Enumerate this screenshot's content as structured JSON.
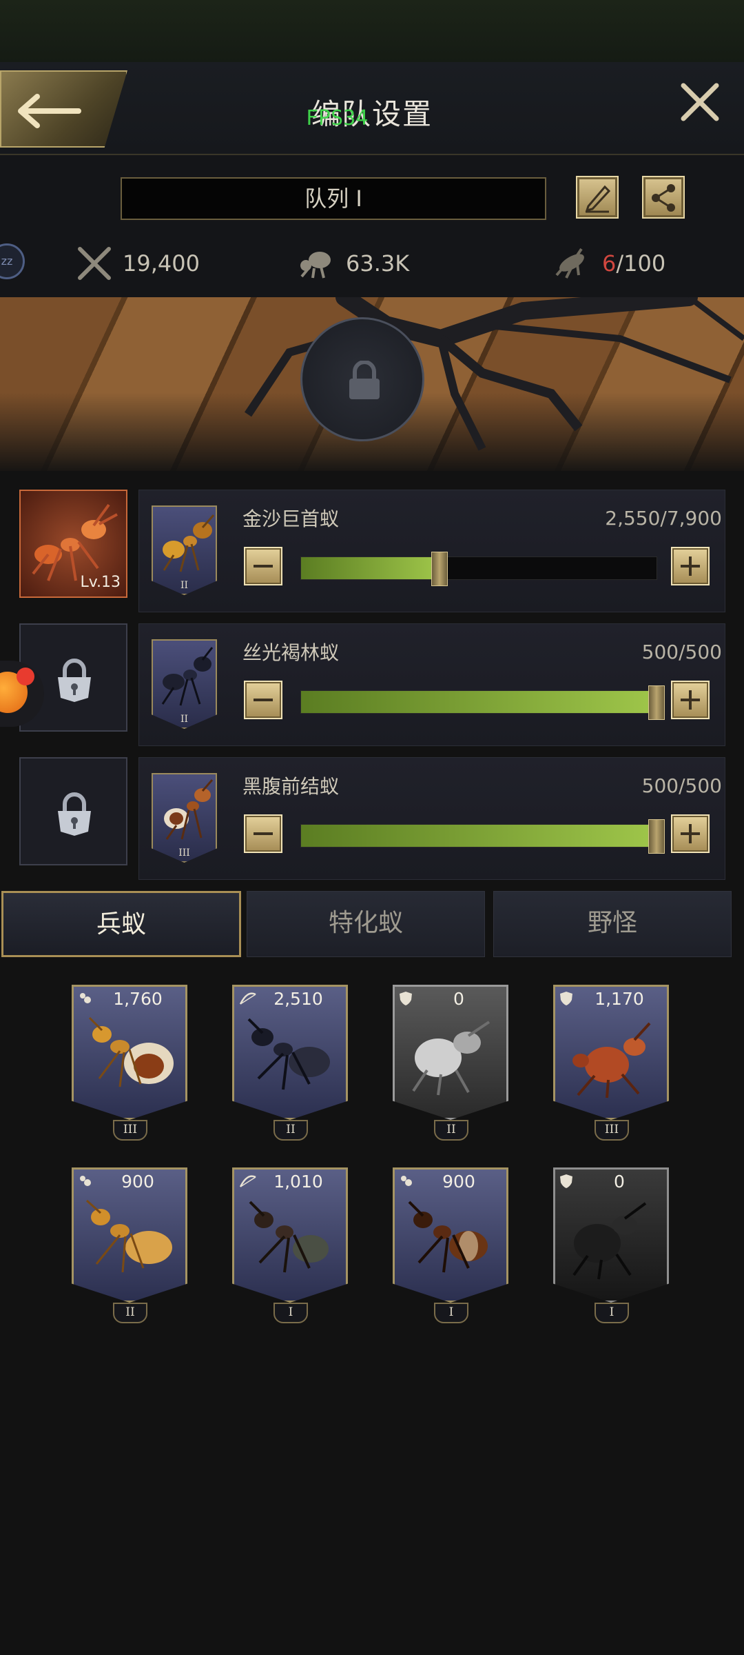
{
  "header": {
    "title": "编队设置",
    "fps_overlay": "FPS34"
  },
  "team": {
    "name": "队列 I",
    "stats": {
      "attack": "19,400",
      "load": "63.3K",
      "count_current": "6",
      "count_max": "/100"
    }
  },
  "slots": [
    {
      "name": "金沙巨首蚁",
      "count": "2,550/7,900",
      "level": "Lv.13",
      "tier": "II",
      "fill": 0.39,
      "locked": false
    },
    {
      "name": "丝光褐林蚁",
      "count": "500/500",
      "level": "",
      "tier": "II",
      "fill": 1.0,
      "locked": true
    },
    {
      "name": "黑腹前结蚁",
      "count": "500/500",
      "level": "",
      "tier": "III",
      "fill": 1.0,
      "locked": true
    }
  ],
  "tabs": [
    "兵蚁",
    "特化蚁",
    "野怪"
  ],
  "units": [
    {
      "count": "1,760",
      "tier": "III",
      "type_icon": "ant-icon"
    },
    {
      "count": "2,510",
      "tier": "II",
      "type_icon": "bow-icon"
    },
    {
      "count": "0",
      "tier": "II",
      "type_icon": "shield-icon"
    },
    {
      "count": "1,170",
      "tier": "III",
      "type_icon": "shield-icon"
    },
    {
      "count": "900",
      "tier": "II",
      "type_icon": "ant-icon"
    },
    {
      "count": "1,010",
      "tier": "I",
      "type_icon": "bow-icon"
    },
    {
      "count": "900",
      "tier": "I",
      "type_icon": "ant-icon"
    },
    {
      "count": "0",
      "tier": "I",
      "type_icon": "shield-icon"
    }
  ],
  "colors": {
    "accent_gold": "#b8a56a",
    "slider_green": "#9fc64a",
    "warning_red": "#d1473f"
  }
}
